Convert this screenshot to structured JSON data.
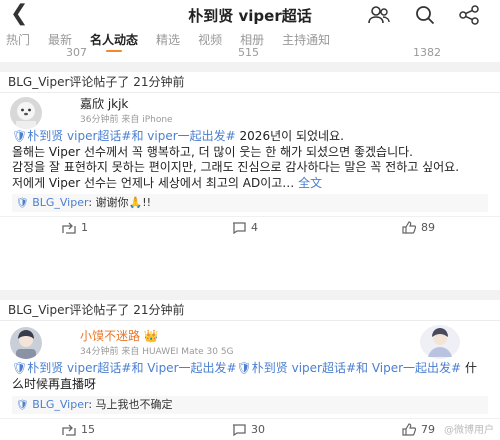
{
  "header": {
    "title": "朴到贤 viper超话",
    "icons": [
      "back-icon",
      "people-icon",
      "search-icon",
      "share-icon"
    ]
  },
  "tabs": [
    {
      "label": "热门",
      "active": false
    },
    {
      "label": "最新",
      "active": false
    },
    {
      "label": "名人动态",
      "active": true
    },
    {
      "label": "精选",
      "active": false
    },
    {
      "label": "视频",
      "active": false
    },
    {
      "label": "相册",
      "active": false
    },
    {
      "label": "主持通知",
      "active": false
    }
  ],
  "prev_stats": {
    "a": "307",
    "b": "515",
    "c": "1382"
  },
  "posts": [
    {
      "head": "BLG_Viper评论帖子了 21分钟前",
      "user": {
        "name": "嘉欣 jkjk",
        "time": "36分钟前",
        "source": "来自 iPhone"
      },
      "tag": "🛡朴到贤 viper超话#和 viper一起出发#",
      "text_1": " 2026년이 되었네요.",
      "text_2": "올해는 Viper 선수께서 꼭 행복하고, 더 많이 웃는 한 해가 되셨으면 좋겠습니다.",
      "text_3": "감정을 잘 표현하지 못하는 편이지만, 그래도 진심으로 감사하다는 말은 꼭 전하고 싶어요.",
      "text_4": "저에게 Viper 선수는 언제나 세상에서 최고의 AD이고… ",
      "more": "全文",
      "reply_name": "BLG_Viper",
      "reply_text": ": 谢谢你🙏!!",
      "stats": {
        "share": "1",
        "comment": "4",
        "like": "89"
      }
    },
    {
      "head": "BLG_Viper评论帖子了 21分钟前",
      "user": {
        "name": "小馍不迷路 👑",
        "time": "34分钟前",
        "source": "来自 HUAWEI Mate 30 5G"
      },
      "tag": "🛡朴到贤 viper超话#和 Viper一起出发#🛡朴到贤 viper超话#和 Viper一起出发#",
      "text_1": " 什么时候再直播呀",
      "reply_name": "BLG_Viper",
      "reply_text": ": 马上我也不确定",
      "stats": {
        "share": "15",
        "comment": "30",
        "like": "79"
      }
    }
  ],
  "watermark": "@微博用户",
  "colors": {
    "accent": "#f08a2b",
    "link": "#4a7fd1"
  }
}
